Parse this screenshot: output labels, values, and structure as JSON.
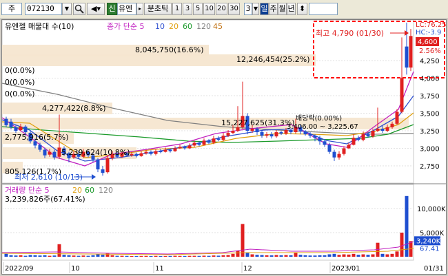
{
  "toolbar": {
    "market": "주",
    "code": "072130",
    "sin": "신",
    "name": "유엔",
    "minute_tick": "분초틱",
    "periods": [
      "1",
      "3",
      "5",
      "10",
      "20",
      "30"
    ],
    "count": "3",
    "day": "일",
    "week": "주",
    "month": "월",
    "year": "년"
  },
  "legend": {
    "title": "유엔젤 매물대 수(10)",
    "close_label": "종가 단순 5",
    "ma": [
      "10",
      "20",
      "60",
      "120",
      "45"
    ]
  },
  "price_axis": {
    "ticks": [
      "4,250",
      "4,000",
      "3,750",
      "3,500",
      "3,250",
      "3,000",
      "2,750"
    ],
    "current": "4,600",
    "change_pct": "2.56%",
    "lc": "LC:76.25",
    "hc": "HC:-3.9"
  },
  "volume_profile": [
    {
      "label": "8,045,750(16.6%)"
    },
    {
      "label": "12,246,454(25.2%)"
    },
    {
      "label": "0(0.0%)"
    },
    {
      "label": "0(0.0%)"
    },
    {
      "label": "0(0.0%)"
    },
    {
      "label": "4,277,422(8.8%)"
    },
    {
      "label": "15,227,625(31.3%)"
    },
    {
      "label": "2,775,916(5.7%)"
    },
    {
      "label": "5,239,624(10.8%)"
    },
    {
      "label": "805,126(1.7%)"
    }
  ],
  "annotations": {
    "high": "최고 4,790 (01/30)",
    "low": "최저 2,610 (10/13)",
    "bae": "배당락(0.00%)",
    "range_label": "3,406.00 ~ 3,225.67"
  },
  "volume": {
    "title": "거래량 단순 5",
    "ma": [
      "20",
      "60",
      "120"
    ],
    "value": "3,239,826주(67.41%)",
    "ticks": [
      "10,000K",
      "5,000K"
    ],
    "current": "3,240K",
    "pct": "67.41"
  },
  "dates": [
    "2022/09",
    "10",
    "11",
    "12",
    "2023/01",
    "01/31"
  ],
  "colors": {
    "up": "#e02020",
    "down": "#1f4fd0"
  }
}
